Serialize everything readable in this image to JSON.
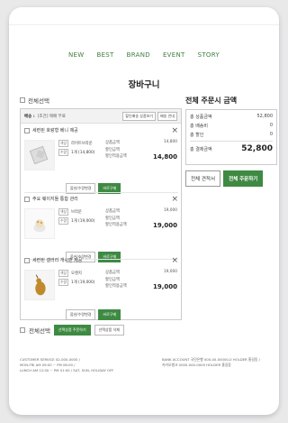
{
  "nav": [
    "NEW",
    "BEST",
    "BRAND",
    "EVENT",
    "STORY"
  ],
  "page_title": "장바구니",
  "select_all": "전체선택",
  "shipping": {
    "label": "배송 :",
    "tag": "[조건] 택배 무료",
    "btn1": "할인배송 상품보기",
    "btn2": "배송 안내"
  },
  "items": [
    {
      "name": "세련된 호랑형 베니 제공",
      "option_badge": "색상",
      "option": "라이트브라운",
      "qty_badge": "수량",
      "qty": "1개 (14,800)",
      "price_label": "상품금액",
      "price": "14,800",
      "discount_label": "할인금액",
      "discount": "",
      "pay_label": "할인적용금액",
      "pay": "14,800",
      "btn_option": "옵션/수량변경",
      "btn_buy": "바로구매"
    },
    {
      "name": "주요 웨이지들 통합 관리",
      "option_badge": "색상",
      "option": "브라운",
      "qty_badge": "수량",
      "qty": "1개 (19,000)",
      "price_label": "상품금액",
      "price": "19,000",
      "discount_label": "할인금액",
      "discount": "",
      "pay_label": "할인적용금액",
      "pay": "19,000",
      "btn_option": "옵션/수량변경",
      "btn_buy": "바로구매"
    },
    {
      "name": "세련된 갤러리 개시판 제공",
      "option_badge": "색상",
      "option": "오렌지",
      "qty_badge": "수량",
      "qty": "1개 (19,000)",
      "price_label": "상품금액",
      "price": "19,000",
      "discount_label": "할인금액",
      "discount": "",
      "pay_label": "할인적용금액",
      "pay": "19,000",
      "btn_option": "옵션/수량변경",
      "btn_buy": "바로구매"
    }
  ],
  "summary": {
    "title": "전체 주문시 금액",
    "rows": [
      {
        "label": "총 상품금액",
        "value": "52,800"
      },
      {
        "label": "총 배송비",
        "value": "0"
      },
      {
        "label": "총 할인",
        "value": "0"
      }
    ],
    "total_label": "총 결제금액",
    "total_value": "52,800",
    "btn_estimate": "전체 견적서",
    "btn_order": "전체 주문하기"
  },
  "bottom": {
    "select_all": "전체선택",
    "btn_order_selected": "선택상품 주문하기",
    "btn_delete_selected": "선택상품 삭제"
  },
  "footer": {
    "cs_line": "CUSTOMER SERVICE  02-000-0000 /",
    "hours_line": "MON-FRI AM 09:00 ~ PM 06:00 /",
    "lunch_line": "LUNCH AM 12:00 ~ PM 01:00 / SAT, SUN, HOLIDAY OFF",
    "bank_line": "BANK ACCOUNT  국민은행 000-00-00000-0 HOLDER 홍길동 /",
    "bank_line2": "카카오뱅크 0000-000-0000 HOLDER 홍길동"
  },
  "colors": {
    "accent": "#3e8a43",
    "nav": "#3e7d3f"
  }
}
